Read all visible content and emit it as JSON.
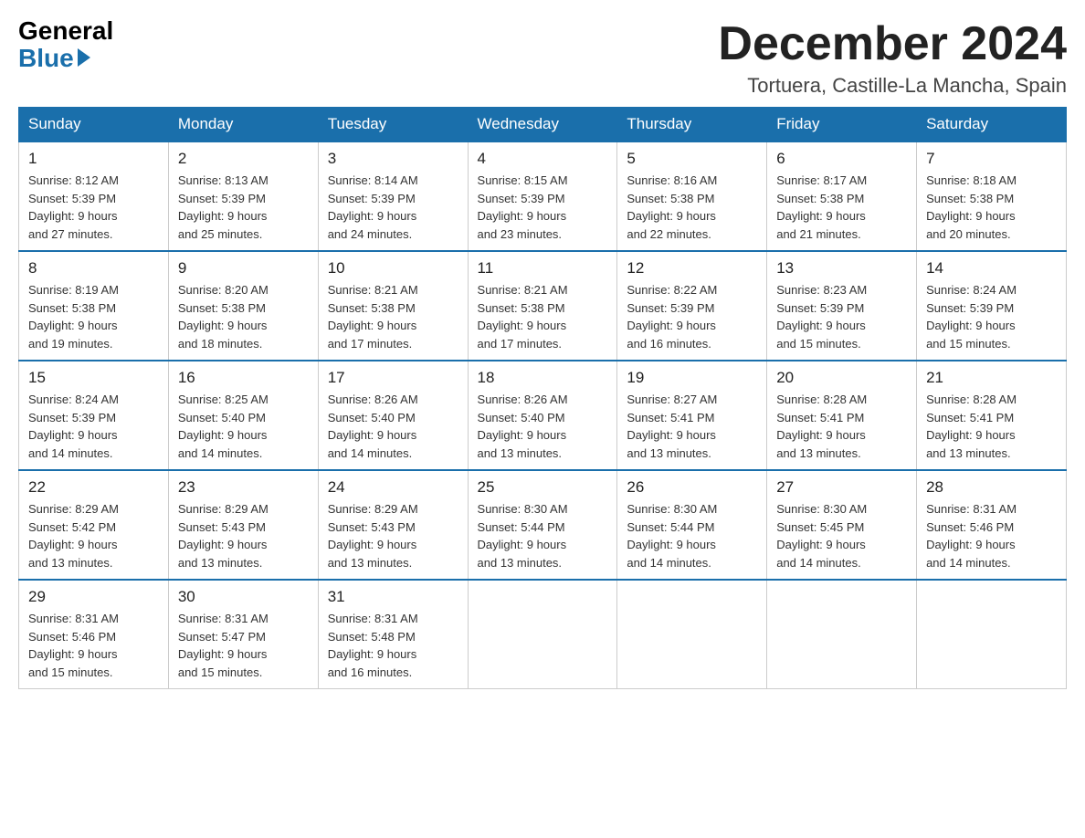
{
  "logo": {
    "general": "General",
    "blue": "Blue"
  },
  "title": "December 2024",
  "location": "Tortuera, Castille-La Mancha, Spain",
  "headers": [
    "Sunday",
    "Monday",
    "Tuesday",
    "Wednesday",
    "Thursday",
    "Friday",
    "Saturday"
  ],
  "weeks": [
    [
      {
        "day": "1",
        "sunrise": "8:12 AM",
        "sunset": "5:39 PM",
        "daylight": "9 hours and 27 minutes."
      },
      {
        "day": "2",
        "sunrise": "8:13 AM",
        "sunset": "5:39 PM",
        "daylight": "9 hours and 25 minutes."
      },
      {
        "day": "3",
        "sunrise": "8:14 AM",
        "sunset": "5:39 PM",
        "daylight": "9 hours and 24 minutes."
      },
      {
        "day": "4",
        "sunrise": "8:15 AM",
        "sunset": "5:39 PM",
        "daylight": "9 hours and 23 minutes."
      },
      {
        "day": "5",
        "sunrise": "8:16 AM",
        "sunset": "5:38 PM",
        "daylight": "9 hours and 22 minutes."
      },
      {
        "day": "6",
        "sunrise": "8:17 AM",
        "sunset": "5:38 PM",
        "daylight": "9 hours and 21 minutes."
      },
      {
        "day": "7",
        "sunrise": "8:18 AM",
        "sunset": "5:38 PM",
        "daylight": "9 hours and 20 minutes."
      }
    ],
    [
      {
        "day": "8",
        "sunrise": "8:19 AM",
        "sunset": "5:38 PM",
        "daylight": "9 hours and 19 minutes."
      },
      {
        "day": "9",
        "sunrise": "8:20 AM",
        "sunset": "5:38 PM",
        "daylight": "9 hours and 18 minutes."
      },
      {
        "day": "10",
        "sunrise": "8:21 AM",
        "sunset": "5:38 PM",
        "daylight": "9 hours and 17 minutes."
      },
      {
        "day": "11",
        "sunrise": "8:21 AM",
        "sunset": "5:38 PM",
        "daylight": "9 hours and 17 minutes."
      },
      {
        "day": "12",
        "sunrise": "8:22 AM",
        "sunset": "5:39 PM",
        "daylight": "9 hours and 16 minutes."
      },
      {
        "day": "13",
        "sunrise": "8:23 AM",
        "sunset": "5:39 PM",
        "daylight": "9 hours and 15 minutes."
      },
      {
        "day": "14",
        "sunrise": "8:24 AM",
        "sunset": "5:39 PM",
        "daylight": "9 hours and 15 minutes."
      }
    ],
    [
      {
        "day": "15",
        "sunrise": "8:24 AM",
        "sunset": "5:39 PM",
        "daylight": "9 hours and 14 minutes."
      },
      {
        "day": "16",
        "sunrise": "8:25 AM",
        "sunset": "5:40 PM",
        "daylight": "9 hours and 14 minutes."
      },
      {
        "day": "17",
        "sunrise": "8:26 AM",
        "sunset": "5:40 PM",
        "daylight": "9 hours and 14 minutes."
      },
      {
        "day": "18",
        "sunrise": "8:26 AM",
        "sunset": "5:40 PM",
        "daylight": "9 hours and 13 minutes."
      },
      {
        "day": "19",
        "sunrise": "8:27 AM",
        "sunset": "5:41 PM",
        "daylight": "9 hours and 13 minutes."
      },
      {
        "day": "20",
        "sunrise": "8:28 AM",
        "sunset": "5:41 PM",
        "daylight": "9 hours and 13 minutes."
      },
      {
        "day": "21",
        "sunrise": "8:28 AM",
        "sunset": "5:41 PM",
        "daylight": "9 hours and 13 minutes."
      }
    ],
    [
      {
        "day": "22",
        "sunrise": "8:29 AM",
        "sunset": "5:42 PM",
        "daylight": "9 hours and 13 minutes."
      },
      {
        "day": "23",
        "sunrise": "8:29 AM",
        "sunset": "5:43 PM",
        "daylight": "9 hours and 13 minutes."
      },
      {
        "day": "24",
        "sunrise": "8:29 AM",
        "sunset": "5:43 PM",
        "daylight": "9 hours and 13 minutes."
      },
      {
        "day": "25",
        "sunrise": "8:30 AM",
        "sunset": "5:44 PM",
        "daylight": "9 hours and 13 minutes."
      },
      {
        "day": "26",
        "sunrise": "8:30 AM",
        "sunset": "5:44 PM",
        "daylight": "9 hours and 14 minutes."
      },
      {
        "day": "27",
        "sunrise": "8:30 AM",
        "sunset": "5:45 PM",
        "daylight": "9 hours and 14 minutes."
      },
      {
        "day": "28",
        "sunrise": "8:31 AM",
        "sunset": "5:46 PM",
        "daylight": "9 hours and 14 minutes."
      }
    ],
    [
      {
        "day": "29",
        "sunrise": "8:31 AM",
        "sunset": "5:46 PM",
        "daylight": "9 hours and 15 minutes."
      },
      {
        "day": "30",
        "sunrise": "8:31 AM",
        "sunset": "5:47 PM",
        "daylight": "9 hours and 15 minutes."
      },
      {
        "day": "31",
        "sunrise": "8:31 AM",
        "sunset": "5:48 PM",
        "daylight": "9 hours and 16 minutes."
      },
      null,
      null,
      null,
      null
    ]
  ],
  "labels": {
    "sunrise": "Sunrise:",
    "sunset": "Sunset:",
    "daylight": "Daylight:"
  }
}
